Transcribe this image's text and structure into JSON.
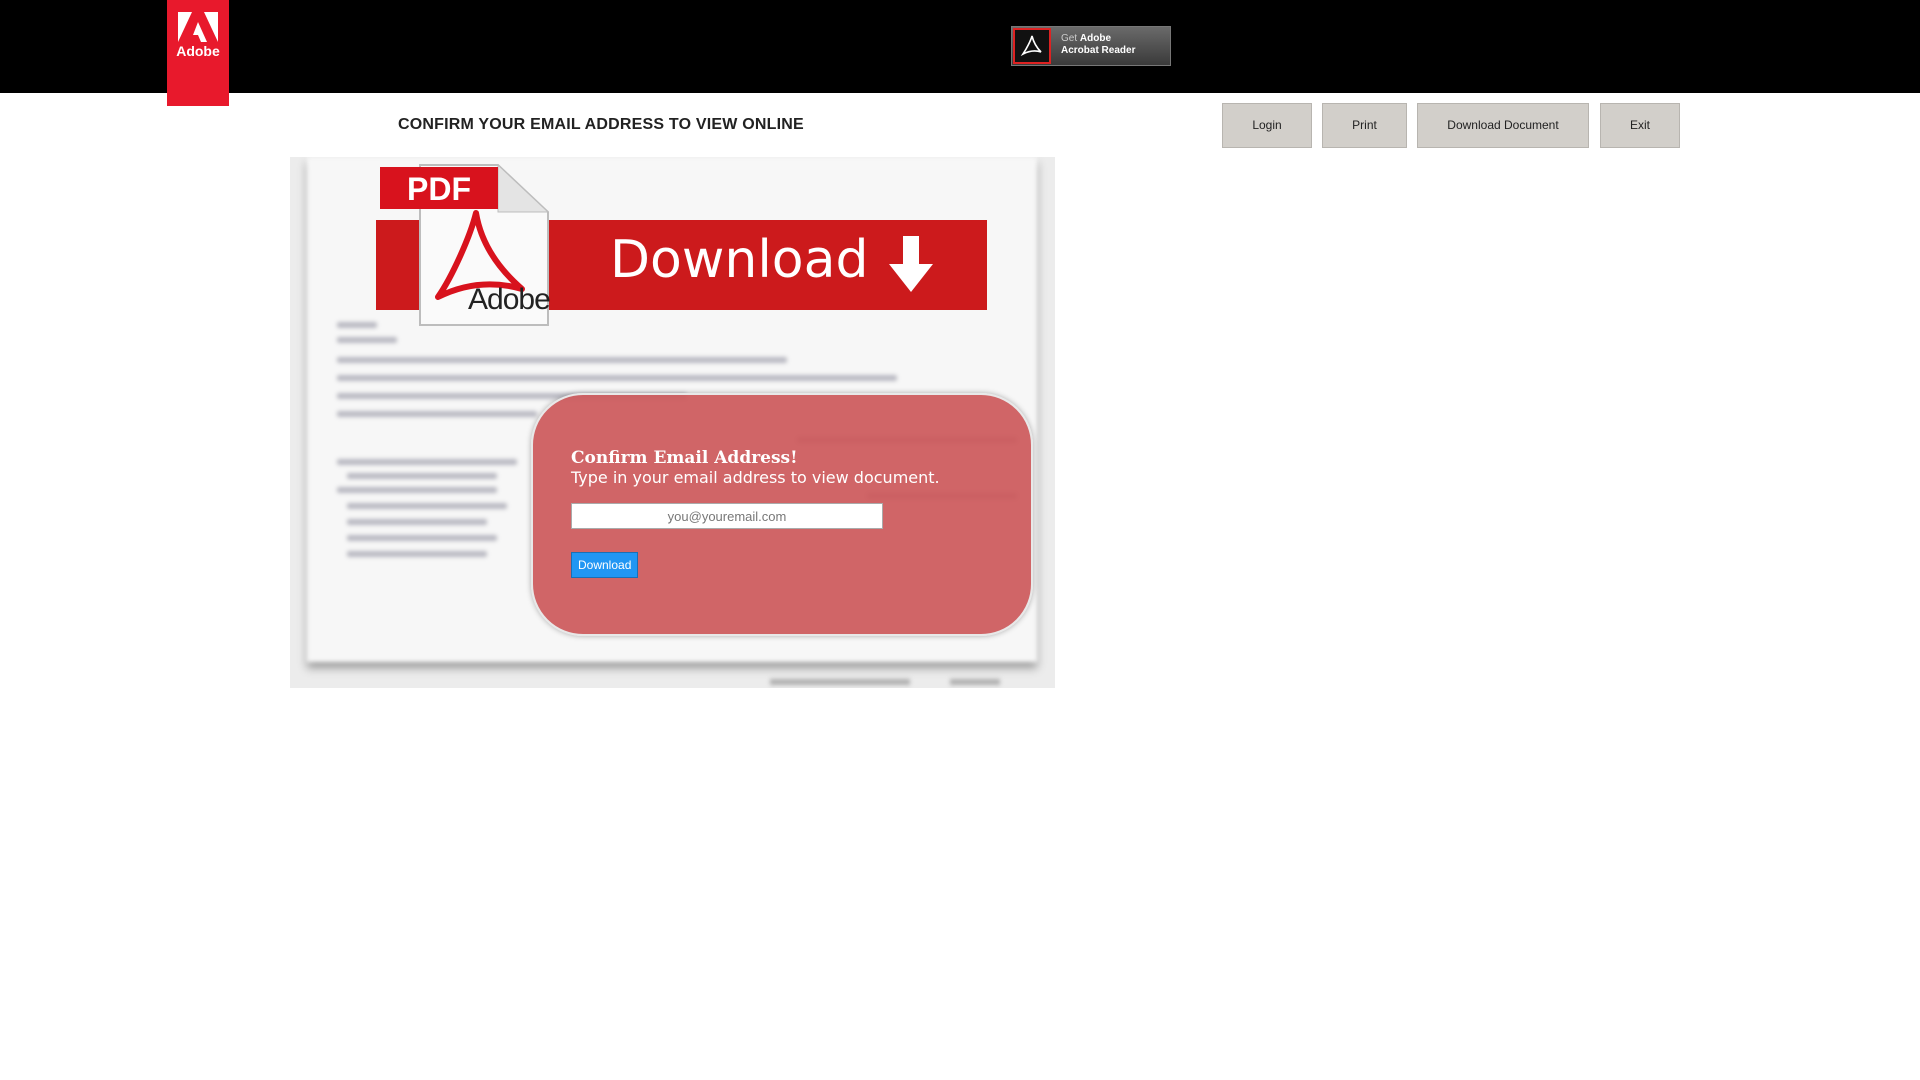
{
  "header": {
    "logo_text": "Adobe",
    "get_reader": {
      "prefix": "Get",
      "brand": "Adobe",
      "product": "Acrobat Reader"
    }
  },
  "page": {
    "heading": "CONFIRM YOUR EMAIL ADDRESS TO VIEW ONLINE"
  },
  "nav": {
    "login": "Login",
    "print": "Print",
    "download_document": "Download Document",
    "exit": "Exit"
  },
  "banner": {
    "pdf_label": "PDF",
    "adobe_label": "Adobe",
    "download_text": "Download"
  },
  "form": {
    "title": "Confirm Email Address!",
    "subtitle": "Type in your email address to view document.",
    "email_placeholder": "you@youremail.com",
    "email_value": "",
    "submit_label": "Download"
  },
  "colors": {
    "adobe_red": "#e8192c",
    "banner_red": "#cc1a1c",
    "panel_red": "#cc585a",
    "button_blue": "#2196f3",
    "nav_button_gray": "#d2cfca",
    "topbar": "#000000"
  },
  "icons": [
    "adobe-logo-icon",
    "acrobat-reader-icon",
    "pdf-document-icon",
    "download-arrow-icon"
  ]
}
